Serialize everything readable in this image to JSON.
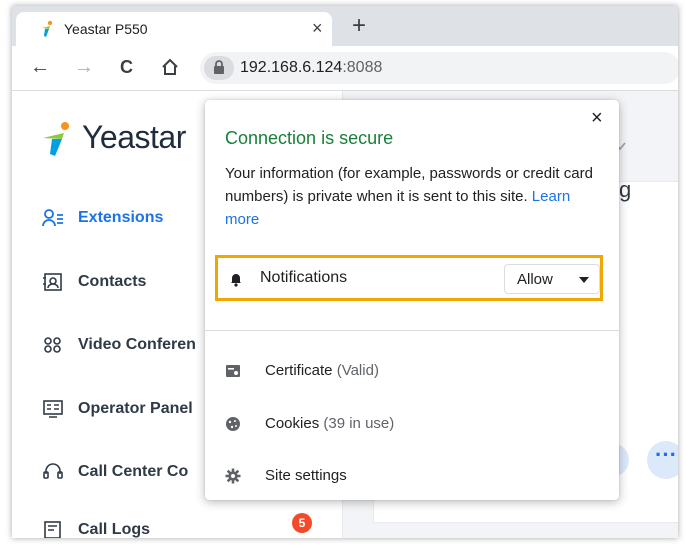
{
  "browser": {
    "tab": {
      "title": "Yeastar P550",
      "close_glyph": "×",
      "favicon": "yeastar-logo-icon"
    },
    "new_tab_glyph": "+",
    "nav": {
      "back_glyph": "←",
      "forward_glyph": "→",
      "reload_glyph": "C",
      "home_icon": "home-icon"
    },
    "address": {
      "host": "192.168.6.124",
      "port": ":8088",
      "lock_icon": "lock-icon"
    }
  },
  "site_info_popup": {
    "close_glyph": "×",
    "title": "Connection is secure",
    "description": "Your information (for example, passwords or credit card numbers) is private when it is sent to this site.",
    "learn_more": "Learn more",
    "notifications": {
      "label": "Notifications",
      "value": "Allow",
      "icon": "bell-icon"
    },
    "certificate": {
      "label": "Certificate",
      "status": "(Valid)",
      "icon": "certificate-icon"
    },
    "cookies": {
      "label": "Cookies",
      "status": "(39 in use)",
      "icon": "cookie-icon"
    },
    "site_settings": {
      "label": "Site settings",
      "icon": "gear-icon"
    }
  },
  "app": {
    "brand": "Yeastar",
    "sidebar": [
      {
        "label": "Extensions",
        "icon": "user-list-icon",
        "active": true
      },
      {
        "label": "Contacts",
        "icon": "contact-card-icon"
      },
      {
        "label": "Video Conferen",
        "icon": "video-conference-icon"
      },
      {
        "label": "Operator Panel",
        "icon": "operator-panel-icon"
      },
      {
        "label": "Call Center Co",
        "icon": "headset-icon"
      },
      {
        "label": "Call Logs",
        "icon": "call-log-icon",
        "badge": "5"
      }
    ],
    "main": {
      "partial_heading": "g",
      "more_glyph": "···"
    }
  },
  "colors": {
    "secure_green": "#188038",
    "link_blue": "#1a73e8",
    "highlight_border": "#f0a800",
    "badge_red": "#f24a2b"
  }
}
